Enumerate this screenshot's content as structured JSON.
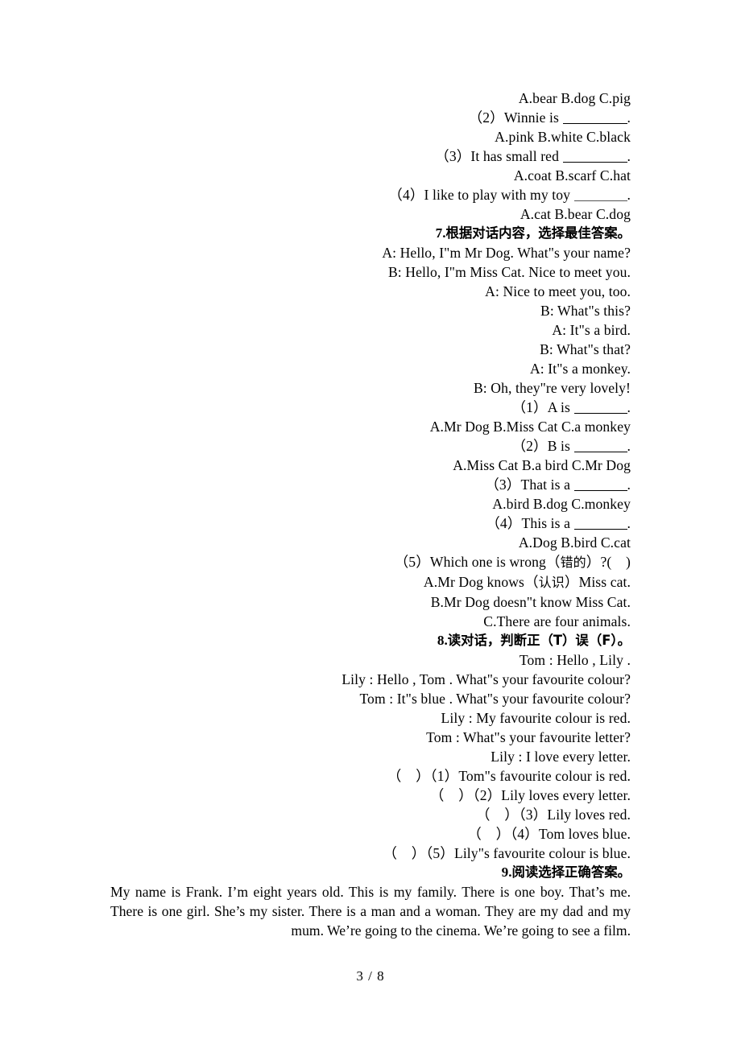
{
  "document": {
    "page_label": "3 / 8",
    "language": "English exam worksheet with Chinese instructions"
  },
  "question6_tail": {
    "options_1": "A.bear   B.dog   C.pig",
    "item_2_text": "（2）Winnie is",
    "item_2_punct": ".",
    "options_2": "A.pink   B.white   C.black",
    "item_3_text": "（3）It has small red",
    "item_3_punct": ".",
    "options_3": "A.coat   B.scarf   C.hat",
    "item_4_text": "（4）I like to play with my toy",
    "item_4_punct": ".",
    "options_4": "A.cat   B.bear   C.dog"
  },
  "section7": {
    "number": "7.",
    "title_cn": "根据对话内容，选择最佳答案。",
    "dialogue": [
      "A: Hello, I\"m Mr Dog. What\"s your name?",
      "B: Hello, I\"m Miss Cat. Nice to meet you.",
      "A: Nice to meet you, too.",
      "B: What\"s this?",
      "A: It\"s a bird.",
      "B: What\"s that?",
      "A: It\"s a monkey.",
      "B: Oh, they\"re very lovely!"
    ],
    "q1_text": "（1）A is",
    "q1_punct": ".",
    "q1_options": "A.Mr Dog   B.Miss Cat   C.a monkey",
    "q2_text": "（2）B is",
    "q2_punct": ".",
    "q2_options": "A.Miss Cat   B.a bird   C.Mr Dog",
    "q3_text": "（3）That is a",
    "q3_punct": ".",
    "q3_options": "A.bird   B.dog   C.monkey",
    "q4_text": "（4）This is a",
    "q4_punct": ".",
    "q4_options": "A.Dog   B.bird   C.cat",
    "q5_text_a": "（5）Which one is wrong（",
    "q5_text_cn": "错的",
    "q5_text_b": "）?(　)",
    "q5_option_a_pre": "A.Mr Dog knows（",
    "q5_option_a_cn": "认识",
    "q5_option_a_post": "）Miss cat.",
    "q5_option_b": "B.Mr Dog doesn\"t know Miss Cat.",
    "q5_option_c": "C.There are four animals."
  },
  "section8": {
    "number": "8.",
    "title_cn": "读对话，判断正（T）误（F）。",
    "dialogue": [
      "Tom : Hello , Lily .",
      "Lily : Hello , Tom . What\"s your favourite colour?",
      "Tom : It\"s blue . What\"s your favourite colour?",
      "Lily : My favourite colour is red.",
      "Tom : What\"s your favourite letter?",
      "Lily : I love every letter."
    ],
    "statements": [
      "（　）（1）Tom\"s favourite colour is red.",
      "（　）（2）Lily loves every letter.",
      "（　）（3）Lily loves red.",
      "（　）（4）Tom loves blue.",
      "（　）（5）Lily\"s favourite colour is blue."
    ]
  },
  "section9": {
    "number": "9.",
    "title_cn": "阅读选择正确答案。",
    "passage": "My name is Frank. I’m eight years old. This is my family. There is one boy. That’s me. There is one girl. She’s my sister. There is a man and a woman. They are my dad and my mum. We’re going to the cinema. We’re going to see a film."
  }
}
